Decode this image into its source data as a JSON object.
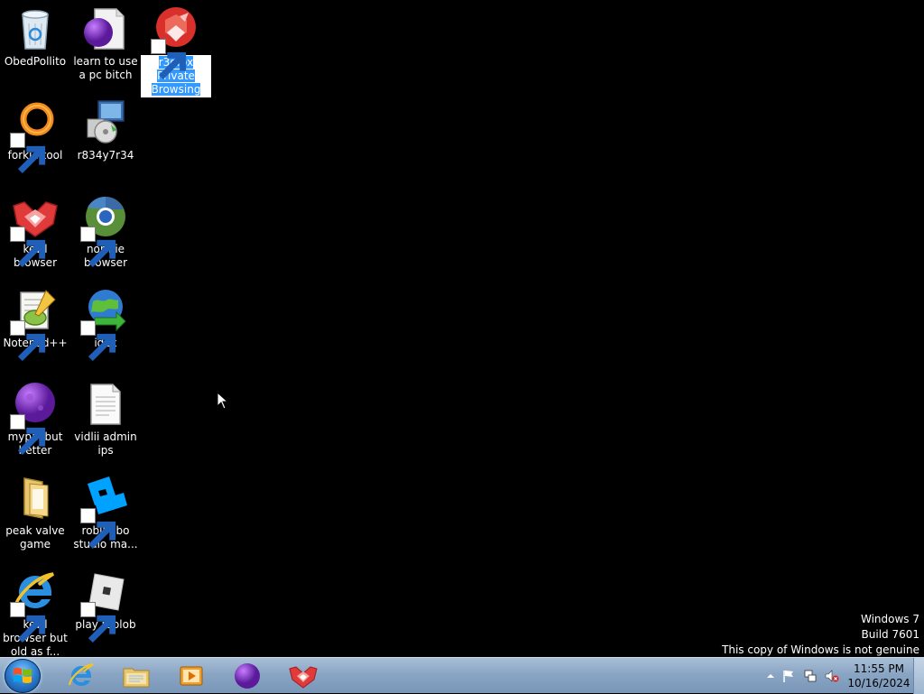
{
  "desktop": {
    "icons": [
      {
        "label": "ObedPollito",
        "icon": "recycle-bin-icon"
      },
      {
        "label": "learn to use a pc bitch",
        "icon": "purple-document-icon"
      },
      {
        "label": "r3dfox Private Browsing",
        "icon": "r3dfox-private-icon"
      },
      {
        "label": "forkie tool",
        "icon": "orange-ring-icon"
      },
      {
        "label": "r834y7r34",
        "icon": "installer-icon"
      },
      {
        "label": "kewl browser",
        "icon": "red-fox-icon"
      },
      {
        "label": "normie browser",
        "icon": "chrome-like-icon"
      },
      {
        "label": "Notepad++",
        "icon": "notepad-plus-plus-icon"
      },
      {
        "label": "idek",
        "icon": "globe-arrow-icon"
      },
      {
        "label": "mypal but better",
        "icon": "purple-planet-icon"
      },
      {
        "label": "vidlii admin ips",
        "icon": "text-file-icon"
      },
      {
        "label": "peak valve game",
        "icon": "folder-icon"
      },
      {
        "label": "roblbobo studio ma...",
        "icon": "roblox-studio-icon"
      },
      {
        "label": "kewl browser but old as f...",
        "icon": "internet-explorer-icon"
      },
      {
        "label": "play roblob",
        "icon": "roblox-icon"
      }
    ]
  },
  "watermark": {
    "line1": "Windows 7",
    "line2": "Build 7601",
    "line3": "This copy of Windows is not genuine"
  },
  "taskbar": {
    "pinned": [
      "internet-explorer-icon",
      "explorer-folder-icon",
      "media-player-icon",
      "purple-planet-icon",
      "red-fox-icon"
    ],
    "clock_time": "11:55 PM",
    "clock_date": "10/16/2024"
  },
  "colors": {
    "taskbar": "#8aa5c4",
    "desktop": "#000000",
    "selection": "#3399ff"
  }
}
